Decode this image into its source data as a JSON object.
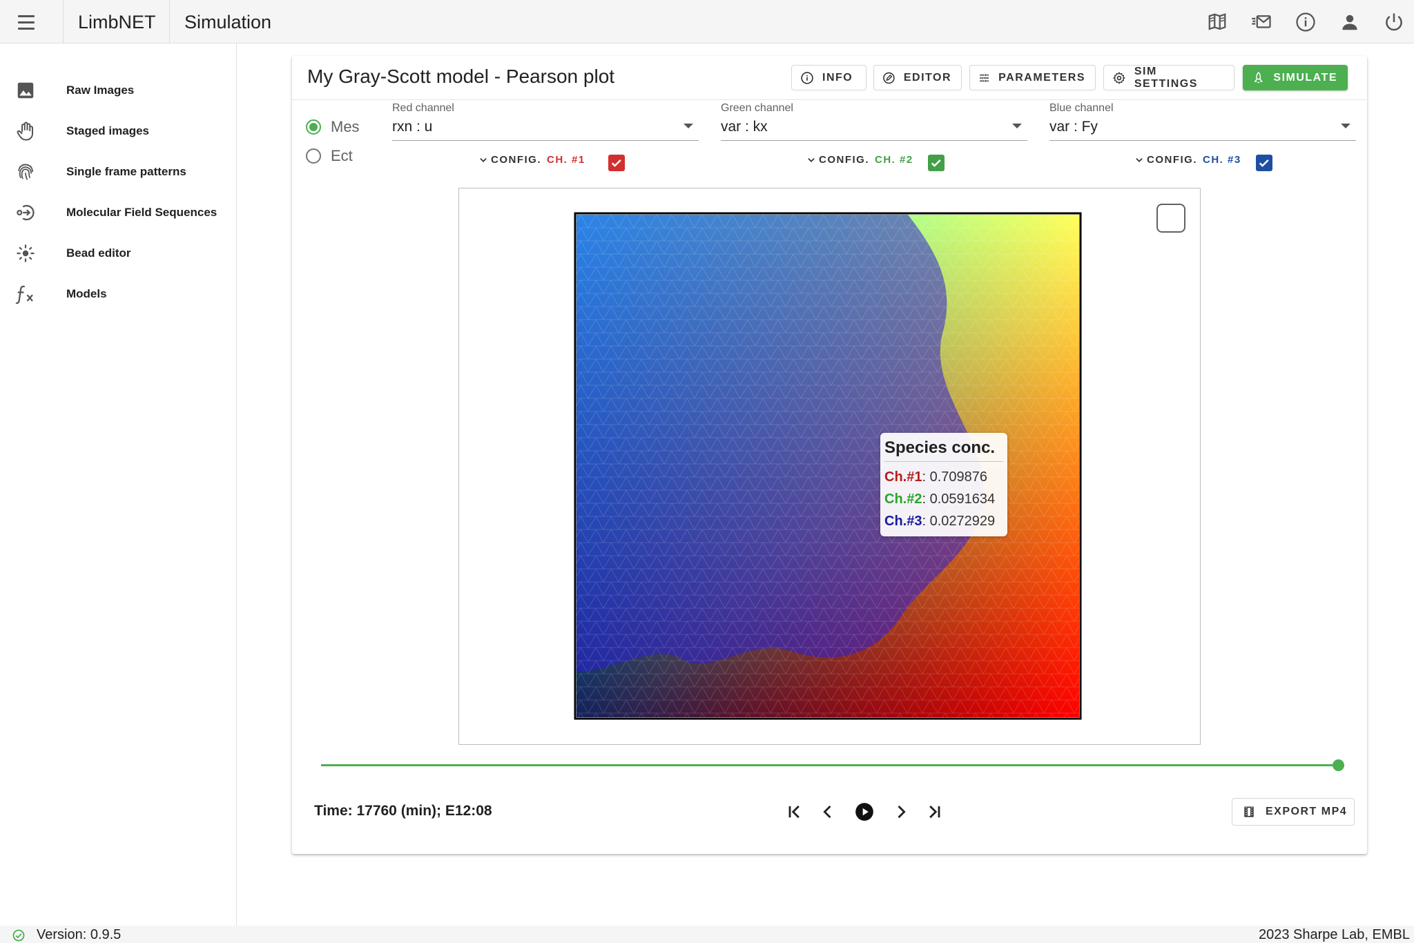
{
  "topbar": {
    "app_title": "LimbNET",
    "page_title": "Simulation",
    "icons": [
      "menu-icon",
      "book-icon",
      "mail-icon",
      "info-icon",
      "account-icon",
      "power-icon"
    ]
  },
  "sidebar": {
    "items": [
      {
        "label": "Raw Images",
        "icon": "image-icon"
      },
      {
        "label": "Staged images",
        "icon": "hand-icon"
      },
      {
        "label": "Single frame patterns",
        "icon": "fingerprint-icon"
      },
      {
        "label": "Molecular Field Sequences",
        "icon": "sequence-icon"
      },
      {
        "label": "Bead editor",
        "icon": "bead-icon"
      },
      {
        "label": "Models",
        "icon": "function-icon"
      }
    ]
  },
  "card": {
    "title": "My Gray-Scott model - Pearson plot",
    "buttons": {
      "info": "INFO",
      "editor": "EDITOR",
      "parameters": "PARAMETERS",
      "sim_settings": "SIM SETTINGS",
      "simulate": "SIMULATE"
    },
    "tissue": {
      "options": [
        "Mes",
        "Ect"
      ],
      "selected": "Mes"
    },
    "channels": [
      {
        "label": "Red channel",
        "value": "rxn : u",
        "config": "CONFIG.",
        "ch": "CH. #1",
        "color": "#d32f2f",
        "checked": true
      },
      {
        "label": "Green channel",
        "value": "var : kx",
        "config": "CONFIG.",
        "ch": "CH. #2",
        "color": "#43a047",
        "checked": true
      },
      {
        "label": "Blue channel",
        "value": "var : Fy",
        "config": "CONFIG.",
        "ch": "CH. #3",
        "color": "#1e4fa3",
        "checked": true
      }
    ],
    "tooltip": {
      "title": "Species conc.",
      "rows": [
        {
          "key": "Ch.#1",
          "value": ": 0.709876",
          "color": "#b71c1c"
        },
        {
          "key": "Ch.#2",
          "value": ": 0.0591634",
          "color": "#2aa52a"
        },
        {
          "key": "Ch.#3",
          "value": ": 0.0272929",
          "color": "#1a1a9e"
        }
      ]
    },
    "slider": {
      "position": 1.0
    },
    "time_text": "Time: 17760 (min); E12:08",
    "export_label": "EXPORT MP4"
  },
  "footer": {
    "version": "Version: 0.9.5",
    "credit": "2023 Sharpe Lab, EMBL"
  },
  "colors": {
    "accent": "#4caf50",
    "ch1": "#d32f2f",
    "ch2": "#43a047",
    "ch3": "#1e4fa3"
  }
}
